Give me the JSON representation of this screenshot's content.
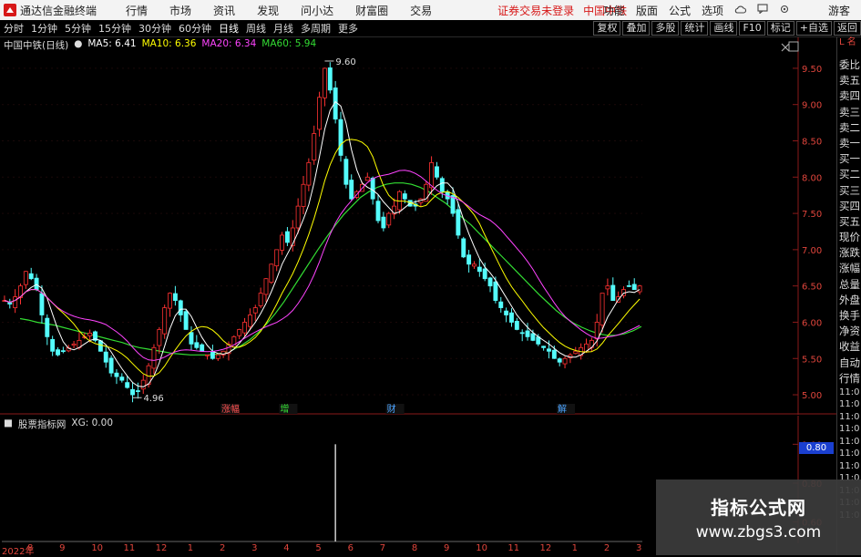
{
  "title_bar": {
    "app_name": "通达信金融终端",
    "menus": [
      "行情",
      "市场",
      "资讯",
      "发现",
      "问小达",
      "财富圈",
      "交易"
    ],
    "notice": "证券交易未登录",
    "stock_name": "中国中铁",
    "right_items": [
      "功能",
      "版面",
      "公式",
      "选项"
    ],
    "guest": "游客"
  },
  "toolbar": {
    "periods": [
      "分时",
      "1分钟",
      "5分钟",
      "15分钟",
      "30分钟",
      "60分钟",
      "日线",
      "周线",
      "月线",
      "多周期",
      "更多"
    ],
    "active_period": "日线",
    "tools": [
      "复权",
      "叠加",
      "多股",
      "统计",
      "画线",
      "F10",
      "标记",
      "+自选",
      "返回"
    ]
  },
  "main_legend": {
    "stock": "中国中铁(日线)",
    "ma": [
      {
        "label": "MA5: 6.41",
        "color": "#ffffff"
      },
      {
        "label": "MA10: 6.36",
        "color": "#ffff00"
      },
      {
        "label": "MA20: 6.34",
        "color": "#ff44ff"
      },
      {
        "label": "MA60: 5.94",
        "color": "#33dd33"
      }
    ]
  },
  "indicator_legend": {
    "name": "股票指标网",
    "value": "XG: 0.00"
  },
  "side_panel": {
    "header": "L 名",
    "items": [
      "委比",
      "卖五",
      "卖四",
      "卖三",
      "卖二",
      "卖一",
      "买一",
      "买二",
      "买三",
      "买四",
      "买五",
      "现价",
      "涨跌",
      "涨幅",
      "总量",
      "外盘",
      "换手",
      "净资",
      "收益",
      "自动",
      "行情"
    ],
    "times": [
      "11:0",
      "11:0",
      "11:0",
      "11:0",
      "11:0",
      "11:0",
      "11:0",
      "11:0",
      "11:0",
      "11:0",
      "11:0"
    ]
  },
  "watermark": {
    "title": "指标公式网",
    "url": "www.zbgs3.com"
  },
  "date_axis": [
    "2022年",
    "8",
    "9",
    "10",
    "11",
    "12",
    "1",
    "2",
    "3",
    "4",
    "5",
    "6",
    "7",
    "8",
    "9",
    "10",
    "11",
    "12",
    "1",
    "2",
    "3"
  ],
  "event_markers": [
    "涨幅",
    "增",
    "财",
    "解"
  ],
  "indicator_current": "0.80",
  "chart_data": {
    "type": "candlestick",
    "title": "中国中铁(日线)",
    "ylim": [
      4.9,
      9.7
    ],
    "y_ticks": [
      5.0,
      5.5,
      6.0,
      6.5,
      7.0,
      7.5,
      8.0,
      8.5,
      9.0,
      9.5
    ],
    "annotations": [
      {
        "label": "9.60",
        "value": 9.6
      },
      {
        "label": "4.96",
        "value": 4.96
      }
    ],
    "close_series": [
      6.3,
      6.25,
      6.35,
      6.5,
      6.7,
      6.6,
      6.45,
      6.1,
      5.8,
      5.6,
      5.55,
      5.6,
      5.65,
      5.7,
      5.75,
      5.8,
      5.85,
      5.75,
      5.6,
      5.45,
      5.3,
      5.25,
      5.2,
      5.1,
      5.0,
      5.05,
      5.2,
      5.4,
      5.65,
      5.9,
      6.2,
      6.4,
      6.3,
      6.1,
      5.9,
      5.7,
      5.65,
      5.6,
      5.55,
      5.5,
      5.55,
      5.6,
      5.7,
      5.8,
      5.9,
      6.0,
      6.1,
      6.2,
      6.4,
      6.6,
      6.8,
      7.0,
      7.2,
      7.1,
      7.3,
      7.6,
      7.9,
      8.2,
      8.6,
      9.1,
      9.5,
      9.2,
      8.8,
      8.3,
      7.9,
      7.7,
      7.8,
      7.9,
      8.0,
      7.7,
      7.4,
      7.3,
      7.5,
      7.6,
      7.8,
      7.7,
      7.6,
      7.6,
      7.7,
      7.9,
      8.2,
      8.0,
      7.8,
      7.7,
      7.5,
      7.2,
      6.9,
      6.8,
      6.8,
      6.7,
      6.6,
      6.5,
      6.3,
      6.2,
      6.1,
      6.0,
      5.9,
      5.85,
      5.8,
      5.75,
      5.7,
      5.65,
      5.6,
      5.5,
      5.45,
      5.5,
      5.55,
      5.6,
      5.65,
      5.7,
      5.75,
      6.0,
      6.4,
      6.5,
      6.3,
      6.35,
      6.45,
      6.5,
      6.45,
      6.5
    ],
    "ma60_series": [
      6.05,
      6.03,
      6.0,
      5.98,
      5.96,
      5.93,
      5.9,
      5.87,
      5.84,
      5.81,
      5.78,
      5.75,
      5.72,
      5.68,
      5.65,
      5.63,
      5.61,
      5.59,
      5.57,
      5.56,
      5.55,
      5.55,
      5.55,
      5.56,
      5.58,
      5.62,
      5.68,
      5.76,
      5.86,
      5.98,
      6.12,
      6.28,
      6.46,
      6.64,
      6.82,
      7.0,
      7.17,
      7.33,
      7.48,
      7.6,
      7.72,
      7.8,
      7.86,
      7.9,
      7.92,
      7.92,
      7.9,
      7.86,
      7.8,
      7.72,
      7.64,
      7.54,
      7.44,
      7.34,
      7.22,
      7.1,
      6.98,
      6.86,
      6.74,
      6.62,
      6.5,
      6.38,
      6.27,
      6.16,
      6.07,
      5.99,
      5.93,
      5.88,
      5.84,
      5.82,
      5.82,
      5.84,
      5.88,
      5.94
    ],
    "indicator": {
      "name": "XG",
      "ylim": [
        0.5,
        1.1
      ],
      "y_ticks": [
        1.0,
        0.8,
        0.6
      ],
      "spike_index": 62,
      "spike_value": 1.0
    }
  }
}
